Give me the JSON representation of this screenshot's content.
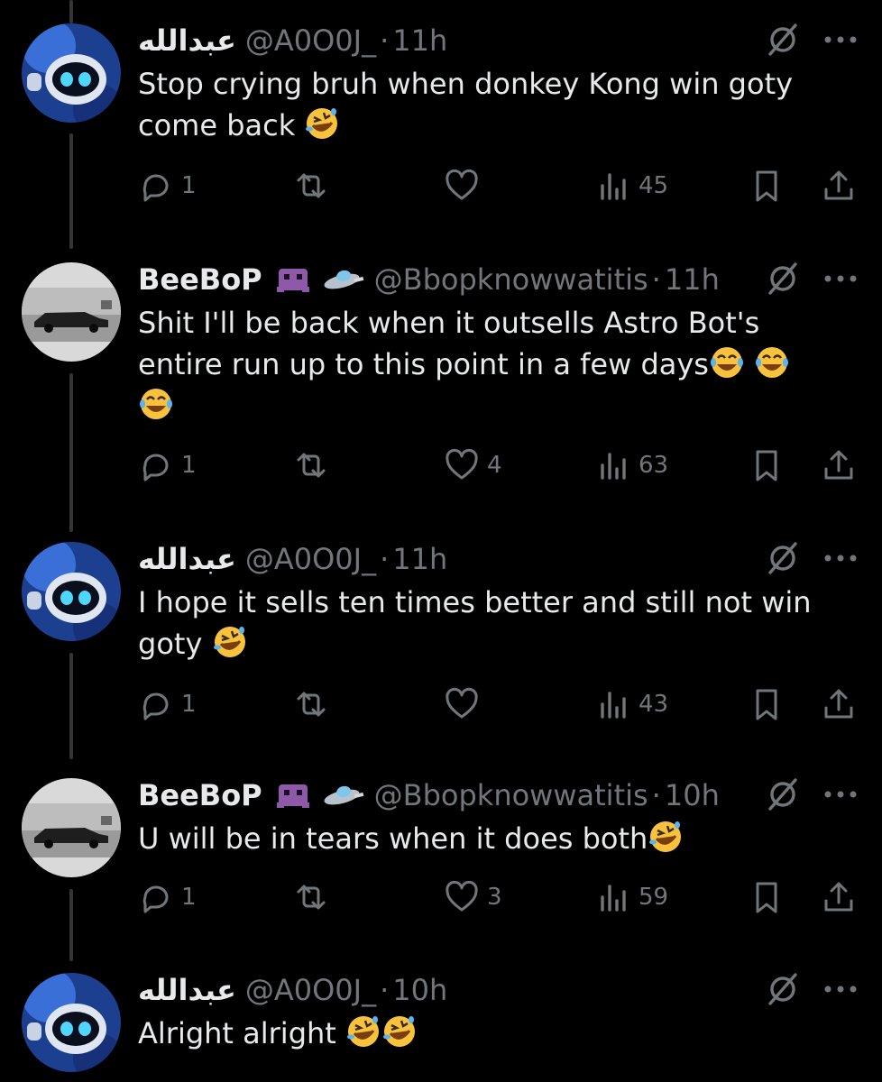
{
  "users": {
    "a": {
      "name": "عبدالله",
      "handle": "@A0O0J_"
    },
    "b": {
      "name": "BeeBoP",
      "handle": "@Bbopknowwatitis",
      "badge_icons": [
        "space-invader-icon",
        "flying-saucer-icon"
      ]
    }
  },
  "separator": "·",
  "tweets": [
    {
      "time": "11h",
      "text": "Stop crying bruh when donkey Kong win goty come back",
      "replies": "1",
      "reposts": "",
      "likes": "",
      "views": "45"
    },
    {
      "time": "11h",
      "text": "Shit I'll be back when it outsells Astro Bot's entire run up to this point in a few days",
      "replies": "1",
      "reposts": "",
      "likes": "4",
      "views": "63"
    },
    {
      "time": "11h",
      "text": "I hope it sells ten  times better and still not win goty",
      "replies": "1",
      "reposts": "",
      "likes": "",
      "views": "43"
    },
    {
      "time": "10h",
      "text": "U will be in tears when it does both",
      "replies": "1",
      "reposts": "",
      "likes": "3",
      "views": "59"
    },
    {
      "time": "10h",
      "text": "Alright alright",
      "replies": "",
      "reposts": "",
      "likes": "",
      "views": ""
    }
  ],
  "colors": {
    "background": "#000000",
    "text": "#e7e9ea",
    "muted": "#71767b",
    "thread_line": "#333639",
    "emoji": "#f9c23c"
  }
}
